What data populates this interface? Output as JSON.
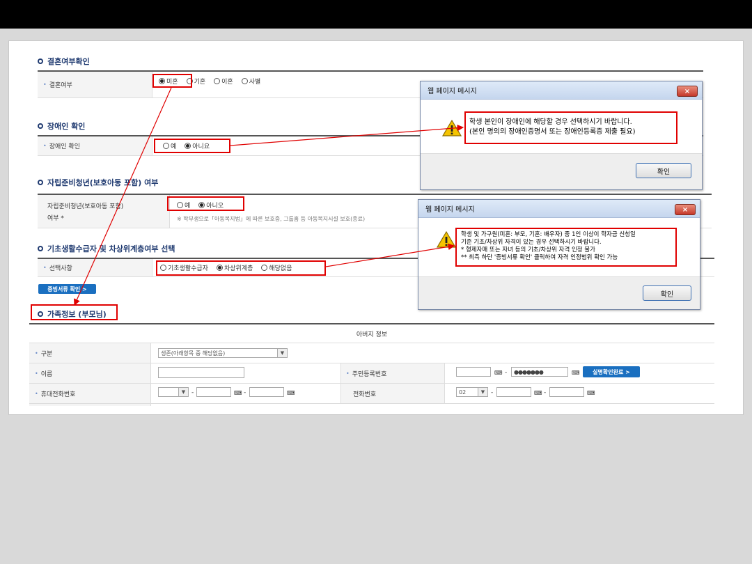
{
  "sections": {
    "marriage": {
      "title": "결혼여부확인",
      "label": "결혼여부",
      "options": [
        "미혼",
        "기혼",
        "이혼",
        "사별"
      ],
      "selected": 0
    },
    "disability": {
      "title": "장애인 확인",
      "label": "장애인 확인",
      "options": [
        "예",
        "아니요"
      ],
      "selected": 1
    },
    "independent": {
      "title": "자립준비청년(보호아동 포함) 여부",
      "label_line1": "자립준비청년(보호아동 포함)",
      "label_line2": "여부 *",
      "options": [
        "예",
        "아니오"
      ],
      "selected": 1,
      "note": "※ 학부생으로「아동복지법」에 따른 보호중, 그룹홈 등 아동복지시설 보호(종료)"
    },
    "basic": {
      "title": "기초생활수급자 및 차상위계층여부 선택",
      "label": "선택사항",
      "options": [
        "기초생활수급자",
        "차상위계층",
        "해당없음"
      ],
      "selected": 1,
      "doc_button": "증빙서류 확인 >"
    },
    "family": {
      "title": "가족정보 (부모님)"
    }
  },
  "dialog1": {
    "title": "웹 페이지 메시지",
    "close": "×",
    "line1": "학생 본인이 장애인에 해당할 경우 선택하시기 바랍니다.",
    "line2": "(본인 명의의 장애인증명서 또는 장애인등록증 제출 필요)",
    "ok": "확인"
  },
  "dialog2": {
    "title": "웹 페이지 메시지",
    "close": "×",
    "line1": "학생 및 가구원(미혼: 부모, 기혼: 배우자) 중 1인 이상이 학자금 신청일",
    "line2": "기준 기초/차상위 자격이 있는 경우 선택하시기 바랍니다.",
    "line3": "* 형제자매 또는 자녀 등의 기초/차상위 자격 인정 불가",
    "line4": "** 최측 하단 '증빙서류 확인' 클릭하여 자격 인정범위 확인 가능",
    "ok": "확인"
  },
  "family_table": {
    "header": "아버지 정보",
    "gubun_label": "구분",
    "gubun_value": "생존(아래항목 중 해당없음)",
    "name_label": "이름",
    "rrn_label": "주민등록번호",
    "rrn_dash": "-",
    "rrn_masked": "●●●●●●●",
    "verify_button": "실명확인완료 >",
    "mobile_label": "휴대전화번호",
    "phone_label": "전화번호",
    "phone_area": "02",
    "dash": "-"
  },
  "colors": {
    "highlight": "#e00000",
    "title_blue": "#1f3a70",
    "button_blue": "#1a6fc0"
  }
}
